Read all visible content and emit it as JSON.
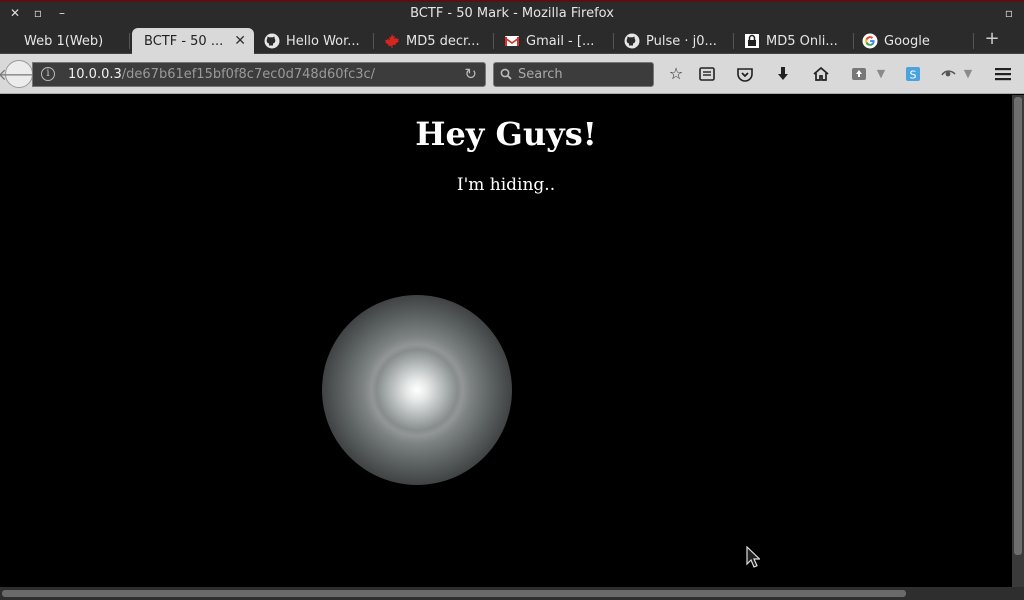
{
  "window": {
    "title": "BCTF - 50 Mark - Mozilla Firefox",
    "close_glyph": "✕",
    "maximize_glyph": "▫",
    "minimize_glyph": "–"
  },
  "tabs": [
    {
      "label": "Web 1(Web)",
      "icon": "none",
      "active": false
    },
    {
      "label": "BCTF - 50 ...",
      "icon": "none",
      "active": true
    },
    {
      "label": "Hello Wor...",
      "icon": "github-icon",
      "active": false
    },
    {
      "label": "MD5 decr...",
      "icon": "maple-leaf-icon",
      "active": false
    },
    {
      "label": "Gmail - [...",
      "icon": "gmail-icon",
      "active": false
    },
    {
      "label": "Pulse · j0...",
      "icon": "github-icon",
      "active": false
    },
    {
      "label": "MD5 Onli...",
      "icon": "lock-icon",
      "active": false
    },
    {
      "label": "Google",
      "icon": "google-icon",
      "active": false
    }
  ],
  "toolbar": {
    "url_host": "10.0.0.3",
    "url_path": "/de67b61ef15bf0f8c7ec0d748d60fc3c/",
    "search_placeholder": "Search",
    "new_tab_glyph": "+"
  },
  "page": {
    "heading": "Hey Guys!",
    "subtext": "I'm hiding.."
  },
  "colors": {
    "page_background": "#000000",
    "chrome_dark": "#2b2b2b",
    "toolbar_light": "#d9d9d9",
    "text_light": "#ffffff"
  }
}
